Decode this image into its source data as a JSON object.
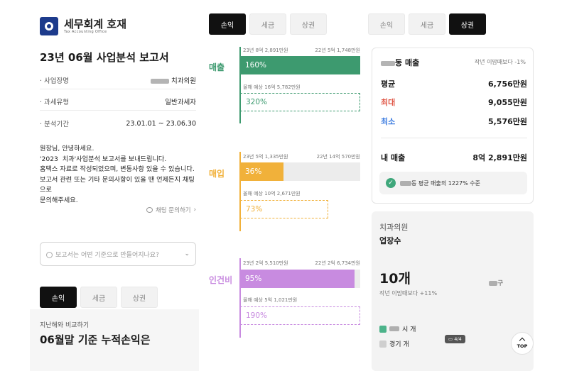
{
  "panel1": {
    "logo": {
      "name": "세무회계 호재",
      "sub": "Tax Accounting Office"
    },
    "report_title": "23년 06월 사업분석 보고서",
    "info": [
      {
        "label": "· 사업장명",
        "value": "치과의원"
      },
      {
        "label": "· 과세유형",
        "value": "일반과세자"
      },
      {
        "label": "· 분석기간",
        "value": "23.01.01 ~ 23.06.30"
      }
    ],
    "greeting": "원장님, 안녕하세요.\n'2023 ​ 치과'사업분석 보고서를 보내드립니다.\n홈택스 자료로 작성되었으며, 변동사항 있을 수 있습니다.\n보고서 관련 또는 기타 문의사항이 있을 땐 언제든지 채팅으로\n문의해주세요.",
    "chat_link": "채팅 문의하기",
    "question_placeholder": "보고서는 어떤 기준으로 만들어지나요?",
    "tabs": [
      "손익",
      "세금",
      "상권"
    ],
    "compare_label": "지난해와 비교하기",
    "cumulative_title": "06월말 기준 누적손익은"
  },
  "panel2": {
    "tabs": [
      "손익",
      "세금",
      "상권"
    ],
    "metrics": [
      {
        "label": "매출",
        "left_cap": "23년 8억 2,891만원",
        "right_cap": "22년 5억 1,748만원",
        "pct": "160%",
        "pct_value": 1.0,
        "est_cap": "올해 예상 16억 5,782만원",
        "est_pct": "320%",
        "color": "#3d9a6f"
      },
      {
        "label": "매입",
        "left_cap": "23년 5억 1,335만원",
        "right_cap": "22년 14억 570만원",
        "pct": "36%",
        "pct_value": 0.36,
        "est_cap": "올해 예상 10억 2,671만원",
        "est_pct": "73%",
        "color": "#f1b13a"
      },
      {
        "label": "인건비",
        "left_cap": "23년 2억 5,510만원",
        "right_cap": "22년 2억 6,734만원",
        "pct": "95%",
        "pct_value": 0.95,
        "est_cap": "올해 예상 5억 1,021만원",
        "est_pct": "190%",
        "color": "#c88be0"
      }
    ]
  },
  "panel3": {
    "tabs": [
      "손익",
      "세금",
      "상권"
    ],
    "sales": {
      "head": "동 매출",
      "sub": "작년 이맘때보다 -1%",
      "avg_label": "평균",
      "avg_value": "6,756만원",
      "max_label": "최대",
      "max_value": "9,055만원",
      "min_label": "최소",
      "min_value": "5,576만원",
      "mine_label": "내 매출",
      "mine_value": "8억 2,891만원",
      "check_text": "동 평균 매출의 1227% 수준"
    },
    "biz": {
      "sub": "치과의원",
      "title": "업장수",
      "count": "10개",
      "compare": "작년 이맘때보다 +11%",
      "district": "구",
      "legend": [
        {
          "label": "시 개",
          "color": "#4cb38a"
        },
        {
          "label": "경기 개",
          "color": "#cfcfcf"
        }
      ],
      "page": "4/4",
      "top_label": "TOP"
    }
  },
  "colors": {
    "revenue": "#3d9a6f",
    "purchase": "#f1b13a",
    "labor": "#c88be0",
    "min": "#3b7be0",
    "max": "#e05a4a"
  }
}
